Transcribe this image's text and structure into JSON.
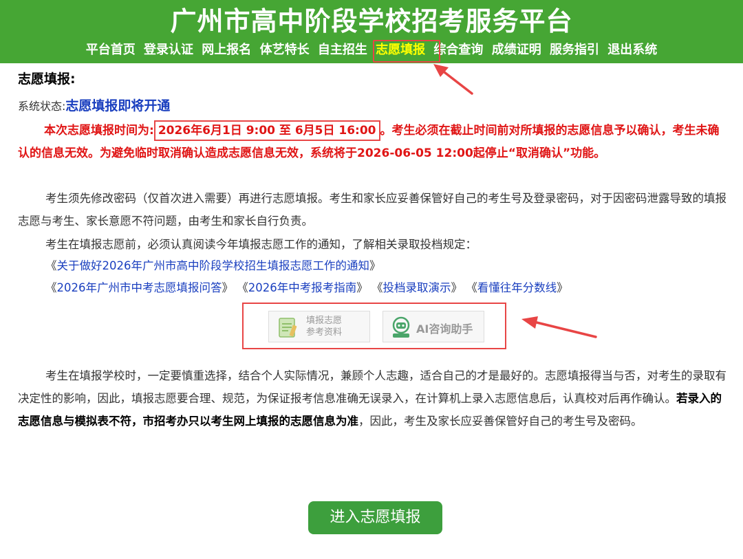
{
  "header": {
    "title": "广州市高中阶段学校招考服务平台",
    "nav": [
      "平台首页",
      "登录认证",
      "网上报名",
      "体艺特长",
      "自主招生",
      "志愿填报",
      "综合查询",
      "成绩证明",
      "服务指引",
      "退出系统"
    ],
    "active_nav": "志愿填报"
  },
  "main": {
    "section_title": "志愿填报:",
    "status_label": "系统状态:",
    "status_value": "志愿填报即将开通",
    "notice_prefix": "本次志愿填报时间为:",
    "notice_time": "2026年6月1日 9:00 至 6月5日 16:00",
    "notice_rest": "。考生必须在截止时间前对所填报的志愿信息予以确认，考生未确认的信息无效。为避免临时取消确认造成志愿信息无效，系统将于2026-06-05 12:00起停止“取消确认”功能。",
    "para1": "考生须先修改密码（仅首次进入需要）再进行志愿填报。考生和家长应妥善保管好自己的考生号及登录密码，对于因密码泄露导致的填报志愿与考生、家长意愿不符问题，由考生和家长自行负责。",
    "para2": "考生在填报志愿前，必须认真阅读今年填报志愿工作的通知，了解相关录取投档规定：",
    "link1": "关于做好2026年广州市高中阶段学校招生填报志愿工作的通知",
    "links_row2": [
      "2026年广州市中考志愿填报问答",
      "2026年中考报考指南",
      "投档录取演示",
      "看懂往年分数线"
    ],
    "ref_button_line1": "填报志愿",
    "ref_button_line2": "参考资料",
    "ai_button": "AI咨询助手",
    "para3_normal": "考生在填报学校时，一定要慎重选择，结合个人实际情况，兼顾个人志趣，适合自己的才是最好的。志愿填报得当与否，对考生的录取有决定性的影响，因此，填报志愿要合理、规范，为保证报考信息准确无误录入，在计算机上录入志愿信息后，认真校对后再作确认。",
    "para3_bold": "若录入的志愿信息与模拟表不符，市招考办只以考生网上填报的志愿信息为准",
    "para3_end": "，因此，考生及家长应妥善保管好自己的考生号及密码。",
    "enter_button": "进入志愿填报"
  },
  "colors": {
    "header_green": "#46a634",
    "highlight_red": "#e84545",
    "link_blue": "#1a3fbf",
    "notice_red": "#e01515",
    "button_green": "#3d9f3d"
  },
  "icons": [
    "document-clipboard-icon",
    "ai-assistant-robot-icon",
    "annotation-arrow-icon"
  ]
}
